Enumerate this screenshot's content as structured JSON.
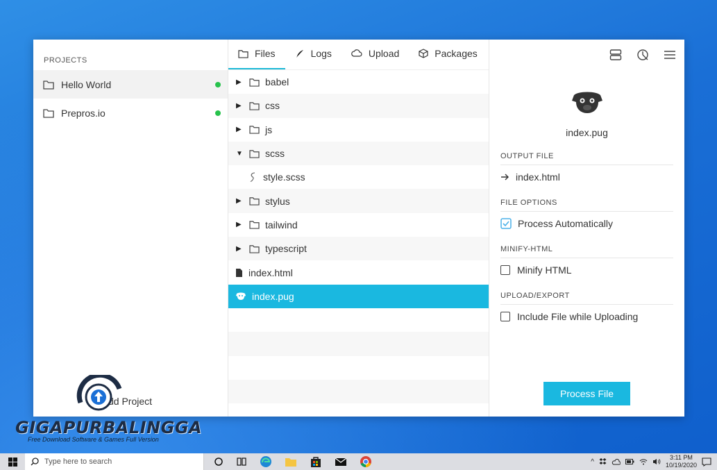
{
  "sidebar": {
    "header": "PROJECTS",
    "projects": [
      {
        "name": "Hello World",
        "status_color": "#27c24c"
      },
      {
        "name": "Prepros.io",
        "status_color": "#27c24c"
      }
    ],
    "add_project_label": "dd Project"
  },
  "tabs": [
    {
      "label": "Files",
      "icon": "folder-icon"
    },
    {
      "label": "Logs",
      "icon": "feather-icon"
    },
    {
      "label": "Upload",
      "icon": "cloud-icon"
    },
    {
      "label": "Packages",
      "icon": "box-icon"
    }
  ],
  "tree": {
    "folders": [
      "babel",
      "css",
      "js",
      "scss"
    ],
    "scss_child": "style.scss",
    "folders2": [
      "stylus",
      "tailwind",
      "typescript"
    ],
    "files": [
      "index.html",
      "index.pug"
    ]
  },
  "detail": {
    "file_name": "index.pug",
    "output_head": "OUTPUT FILE",
    "output_file": "index.html",
    "options_head": "FILE OPTIONS",
    "process_auto": "Process Automatically",
    "minify_head": "MINIFY-HTML",
    "minify_label": "Minify HTML",
    "upload_head": "UPLOAD/EXPORT",
    "upload_label": "Include File while Uploading",
    "process_button": "Process File"
  },
  "watermark": {
    "title": "GIGAPURBALINGGA",
    "subtitle": "Free Download Software & Games Full Version"
  },
  "taskbar": {
    "search_placeholder": "Type here to search",
    "time": "3:11 PM",
    "date": "10/19/2020"
  },
  "colors": {
    "accent": "#1ab8e0",
    "status_green": "#27c24c"
  }
}
